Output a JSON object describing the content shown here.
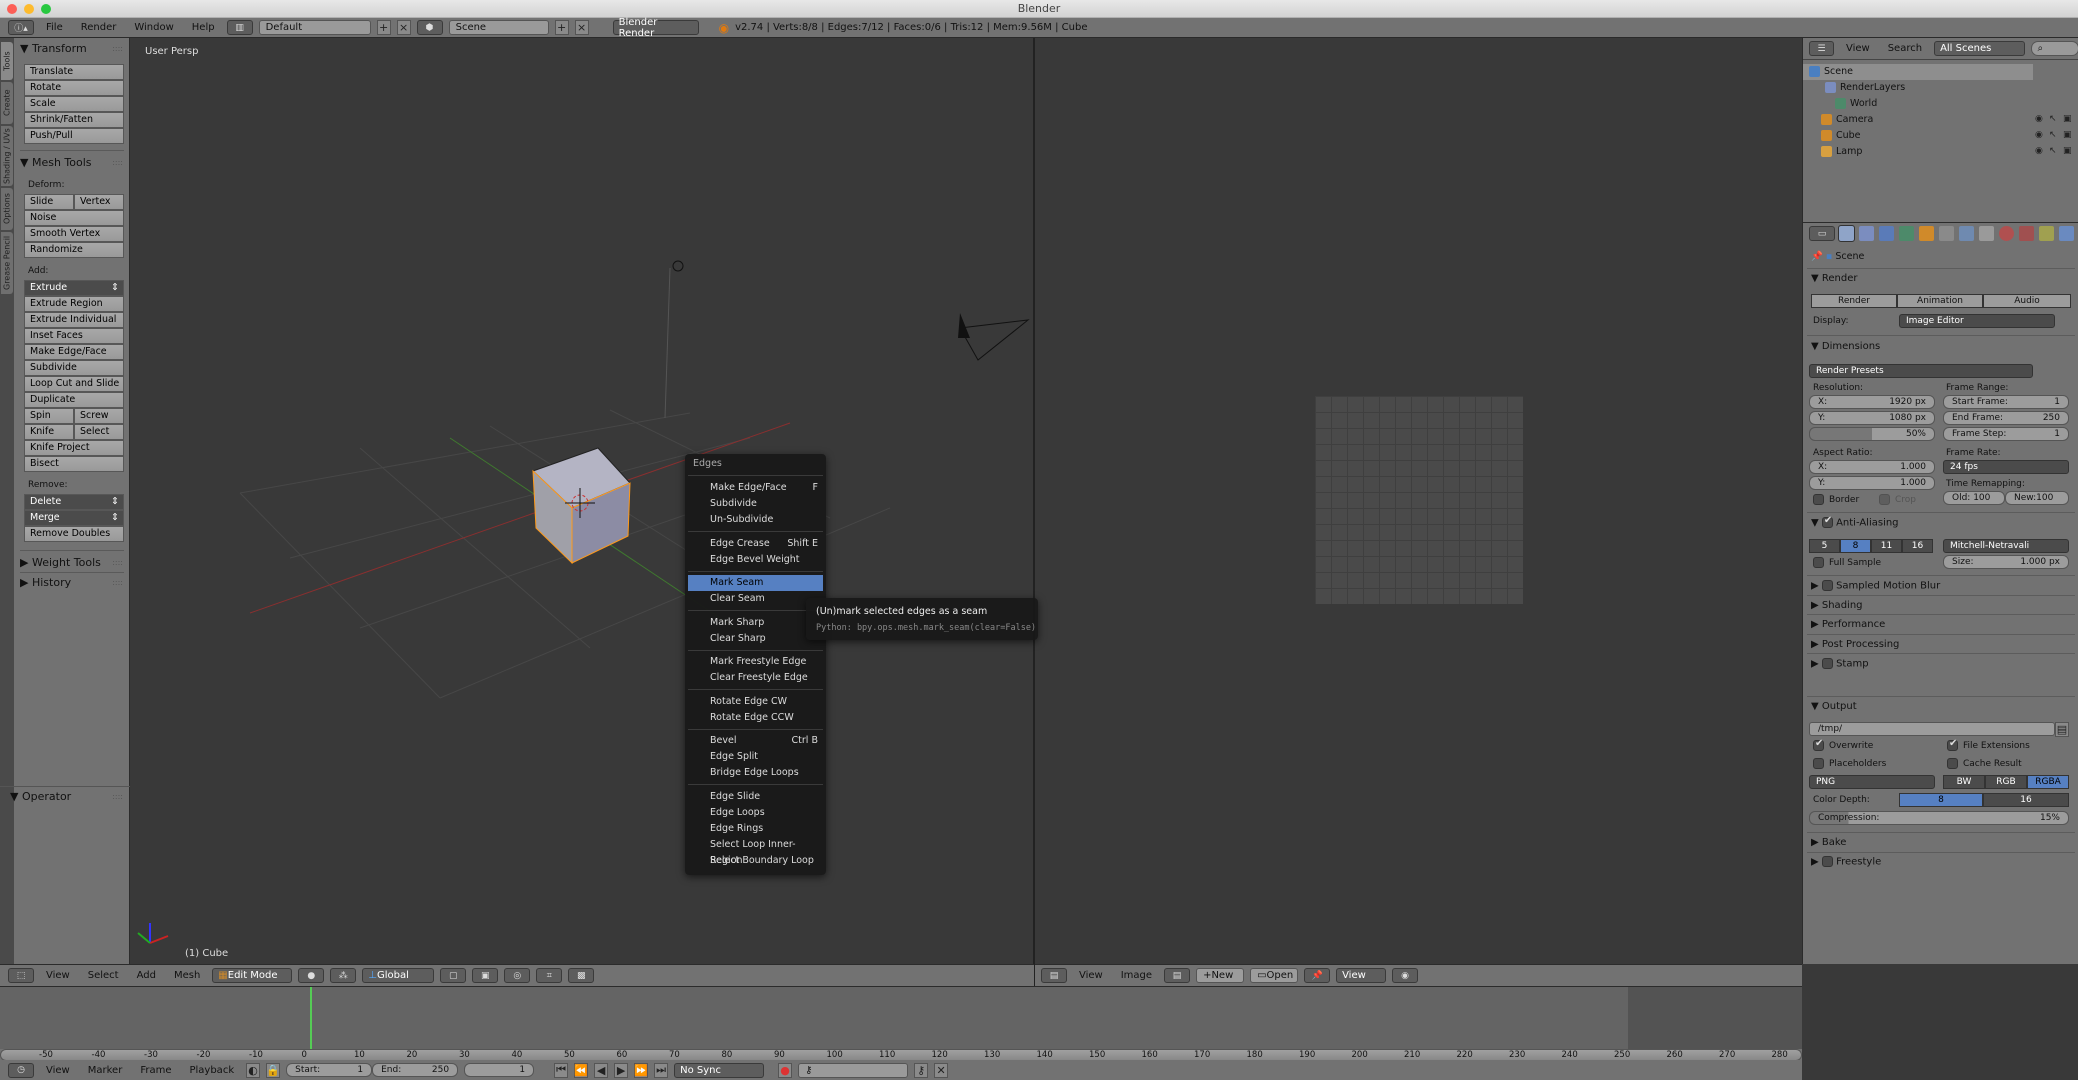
{
  "window": {
    "title": "Blender"
  },
  "infobar": {
    "menus": [
      "File",
      "Render",
      "Window",
      "Help"
    ],
    "layout": "Default",
    "scene": "Scene",
    "engine": "Blender Render",
    "stats": "v2.74 | Verts:8/8 | Edges:7/12 | Faces:0/6 | Tris:12 | Mem:9.56M | Cube"
  },
  "toolshelf": {
    "tabs": [
      "Tools",
      "Create",
      "Shading / UVs",
      "Options",
      "Grease Pencil"
    ],
    "transform": {
      "title": "Transform",
      "buttons": [
        "Translate",
        "Rotate",
        "Scale",
        "Shrink/Fatten",
        "Push/Pull"
      ]
    },
    "mesh_tools": {
      "title": "Mesh Tools",
      "deform_label": "Deform:",
      "deform": [
        "Slide Edg",
        "Vertex",
        "Noise",
        "Smooth Vertex",
        "Randomize"
      ],
      "add_label": "Add:",
      "add": [
        "Extrude",
        "Extrude Region",
        "Extrude Individual",
        "Inset Faces",
        "Make Edge/Face",
        "Subdivide",
        "Loop Cut and Slide",
        "Duplicate",
        "Spin",
        "Screw",
        "Knife",
        "Select",
        "Knife Project",
        "Bisect"
      ],
      "remove_label": "Remove:",
      "remove": [
        "Delete",
        "Merge",
        "Remove Doubles"
      ]
    },
    "collapsed": [
      "Weight Tools",
      "History"
    ],
    "operator": "Operator"
  },
  "viewport": {
    "view_name": "User Persp",
    "object_label": "(1) Cube"
  },
  "context_menu": {
    "title": "Edges",
    "items": [
      {
        "label": "Make Edge/Face",
        "shortcut": "F"
      },
      {
        "label": "Subdivide",
        "shortcut": ""
      },
      {
        "label": "Un-Subdivide",
        "shortcut": ""
      },
      {
        "label": "Edge Crease",
        "shortcut": "Shift E"
      },
      {
        "label": "Edge Bevel Weight",
        "shortcut": ""
      },
      {
        "label": "Mark Seam",
        "shortcut": ""
      },
      {
        "label": "Clear Seam",
        "shortcut": ""
      },
      {
        "label": "Mark Sharp",
        "shortcut": ""
      },
      {
        "label": "Clear Sharp",
        "shortcut": ""
      },
      {
        "label": "Mark Freestyle Edge",
        "shortcut": ""
      },
      {
        "label": "Clear Freestyle Edge",
        "shortcut": ""
      },
      {
        "label": "Rotate Edge CW",
        "shortcut": ""
      },
      {
        "label": "Rotate Edge CCW",
        "shortcut": ""
      },
      {
        "label": "Bevel",
        "shortcut": "Ctrl B"
      },
      {
        "label": "Edge Split",
        "shortcut": ""
      },
      {
        "label": "Bridge Edge Loops",
        "shortcut": ""
      },
      {
        "label": "Edge Slide",
        "shortcut": ""
      },
      {
        "label": "Edge Loops",
        "shortcut": ""
      },
      {
        "label": "Edge Rings",
        "shortcut": ""
      },
      {
        "label": "Select Loop Inner-Region",
        "shortcut": ""
      },
      {
        "label": "Select Boundary Loop",
        "shortcut": ""
      }
    ],
    "highlighted": "Mark Seam"
  },
  "tooltip": {
    "description": "(Un)mark selected edges as a seam",
    "python": "Python: bpy.ops.mesh.mark_seam(clear=False)"
  },
  "view3d_header": {
    "menus": [
      "View",
      "Select",
      "Add",
      "Mesh"
    ],
    "mode": "Edit Mode",
    "orientation": "Global"
  },
  "image_header": {
    "menus": [
      "View",
      "Image"
    ],
    "new": "New",
    "open": "Open",
    "view": "View"
  },
  "outliner": {
    "menus": [
      "View",
      "Search"
    ],
    "filter": "All Scenes",
    "items": [
      {
        "label": "Scene",
        "color": "#4a7fc1"
      },
      {
        "label": "RenderLayers",
        "color": "#7b8dbf"
      },
      {
        "label": "World",
        "color": "#4d8a6a"
      },
      {
        "label": "Camera",
        "color": "#d08a2a"
      },
      {
        "label": "Cube",
        "color": "#d08a2a"
      },
      {
        "label": "Lamp",
        "color": "#d8a040"
      }
    ]
  },
  "properties": {
    "context": "Scene",
    "render": {
      "title": "Render",
      "buttons": [
        "Render",
        "Animation",
        "Audio"
      ],
      "display_label": "Display:",
      "display": "Image Editor"
    },
    "dimensions": {
      "title": "Dimensions",
      "presets": "Render Presets",
      "resolution_label": "Resolution:",
      "res_x": {
        "label": "X:",
        "value": "1920 px"
      },
      "res_y": {
        "label": "Y:",
        "value": "1080 px"
      },
      "res_pct": "50%",
      "frame_range_label": "Frame Range:",
      "start": {
        "label": "Start Frame:",
        "value": "1"
      },
      "end": {
        "label": "End Frame:",
        "value": "250"
      },
      "step": {
        "label": "Frame Step:",
        "value": "1"
      },
      "aspect_label": "Aspect Ratio:",
      "asp_x": {
        "label": "X:",
        "value": "1.000"
      },
      "asp_y": {
        "label": "Y:",
        "value": "1.000"
      },
      "frame_rate_label": "Frame Rate:",
      "fps": "24 fps",
      "time_remap_label": "Time Remapping:",
      "old": "Old: 100",
      "new": "New:100",
      "border": "Border",
      "crop": "Crop"
    },
    "antialiasing": {
      "title": "Anti-Aliasing",
      "samples": [
        "5",
        "8",
        "11",
        "16"
      ],
      "selected": "8",
      "filter": "Mitchell-Netravali",
      "full_sample": "Full Sample",
      "size": {
        "label": "Size:",
        "value": "1.000 px"
      }
    },
    "collapsed": [
      "Sampled Motion Blur",
      "Shading",
      "Performance",
      "Post Processing",
      "Stamp"
    ],
    "output": {
      "title": "Output",
      "path": "/tmp/",
      "overwrite": "Overwrite",
      "file_ext": "File Extensions",
      "placeholders": "Placeholders",
      "cache": "Cache Result",
      "format": "PNG",
      "channels": [
        "BW",
        "RGB",
        "RGBA"
      ],
      "channel_selected": "RGBA",
      "depth_label": "Color Depth:",
      "depths": [
        "8",
        "16"
      ],
      "compression": {
        "label": "Compression:",
        "value": "15%"
      }
    },
    "bottom_collapsed": [
      "Bake",
      "Freestyle"
    ]
  },
  "timeline": {
    "ticks": [
      "-50",
      "-40",
      "-30",
      "-20",
      "-10",
      "0",
      "10",
      "20",
      "30",
      "40",
      "50",
      "60",
      "70",
      "80",
      "90",
      "100",
      "110",
      "120",
      "130",
      "140",
      "150",
      "160",
      "170",
      "180",
      "190",
      "200",
      "210",
      "220",
      "230",
      "240",
      "250",
      "260",
      "270",
      "280"
    ],
    "menus": [
      "View",
      "Marker",
      "Frame",
      "Playback"
    ],
    "start": {
      "label": "Start:",
      "value": "1"
    },
    "end": {
      "label": "End:",
      "value": "250"
    },
    "current": "1",
    "sync": "No Sync"
  }
}
